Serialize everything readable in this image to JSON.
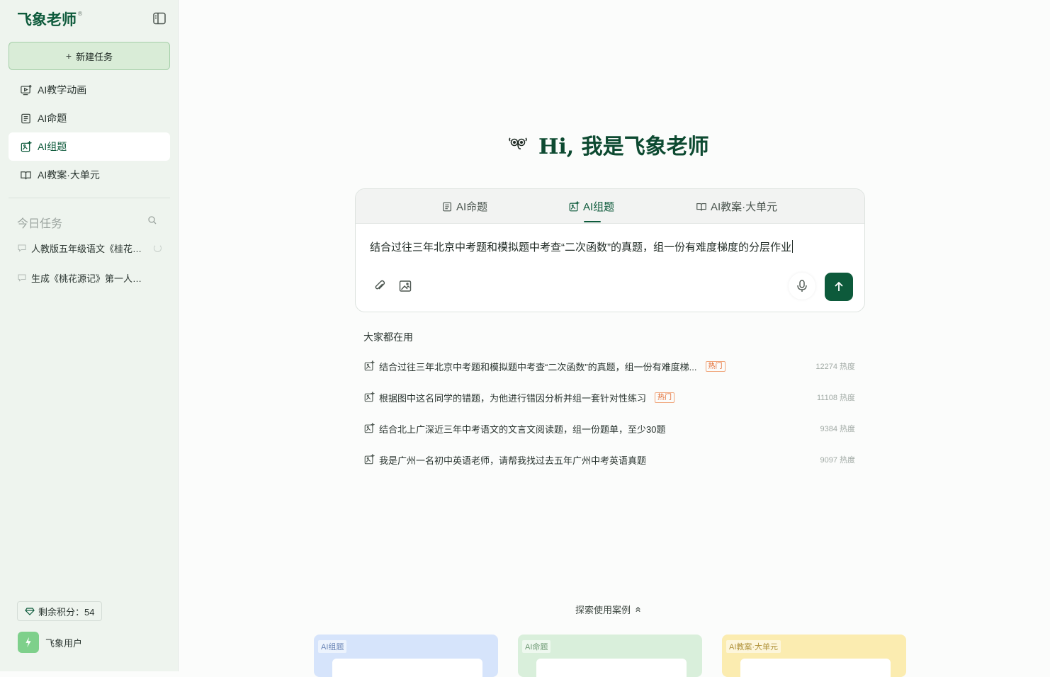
{
  "sidebar": {
    "logo": "飞象老师",
    "logo_mark": "®",
    "new_task": "新建任务",
    "nav": [
      {
        "label": "AI教学动画"
      },
      {
        "label": "AI命题"
      },
      {
        "label": "AI组题"
      },
      {
        "label": "AI教案·大单元"
      }
    ],
    "today_title": "今日任务",
    "tasks": [
      {
        "label": "人教版五年级语文《桂花雨》..."
      },
      {
        "label": "生成《桃花源记》第一人称..."
      }
    ],
    "credits": "剩余积分：54",
    "user_name": "飞象用户"
  },
  "hero": {
    "title": "Hi, 我是飞象老师"
  },
  "composer": {
    "tabs": [
      {
        "label": "AI命题"
      },
      {
        "label": "AI组题"
      },
      {
        "label": "AI教案·大单元"
      }
    ],
    "prompt_text": "结合过往三年北京中考题和模拟题中考查“二次函数”的真题，组一份有难度梯度的分层作业"
  },
  "popular": {
    "title": "大家都在用",
    "hot_label": "热门",
    "items": [
      {
        "text": "结合过往三年北京中考题和模拟题中考查“二次函数”的真题，组一份有难度梯...",
        "hot": true,
        "heat": "12274 热度"
      },
      {
        "text": "根据图中这名同学的错题，为他进行错因分析并组一套针对性练习",
        "hot": true,
        "heat": "11108 热度"
      },
      {
        "text": "结合北上广深近三年中考语文的文言文阅读题，组一份题单，至少30题",
        "hot": false,
        "heat": "9384 热度"
      },
      {
        "text": "我是广州一名初中英语老师，请帮我找过去五年广州中考英语真题",
        "hot": false,
        "heat": "9097 热度"
      }
    ]
  },
  "explore": {
    "label": "探索使用案例",
    "cases": [
      {
        "label": "AI组题",
        "color": "#d6e4fb"
      },
      {
        "label": "AI命题",
        "color": "#d9efdb"
      },
      {
        "label": "AI教案·大单元",
        "color": "#fbecb0"
      }
    ]
  },
  "colors": {
    "accent": "#0d5a3b",
    "sidebar_bg": "#eef4ee",
    "hot": "#e3672b"
  }
}
